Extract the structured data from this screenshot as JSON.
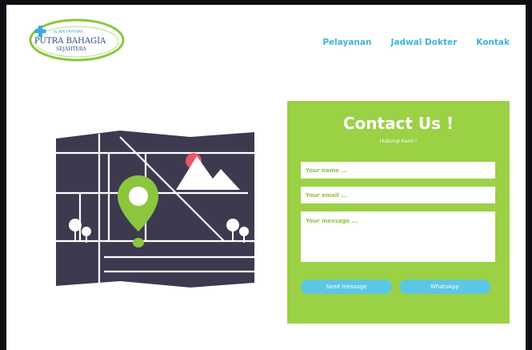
{
  "logo": {
    "small_text": "KLINIK PRATAMA",
    "name": "PUTRA BAHAGIA",
    "tagline": "SEJAHTERA"
  },
  "nav": {
    "items": [
      "Pelayanan",
      "Jadwal Dokter",
      "Kontak"
    ]
  },
  "contact": {
    "title": "Contact Us !",
    "subtitle": "Hubungi Kami !",
    "name_placeholder": "Your name ...",
    "email_placeholder": "Your email ...",
    "message_placeholder": "Your message ...",
    "send_label": "Send message",
    "whatsapp_label": "WhatsApp"
  },
  "colors": {
    "accent_green": "#9bd145",
    "accent_blue": "#5cc7e4",
    "map_dark": "#3d3a4f"
  }
}
